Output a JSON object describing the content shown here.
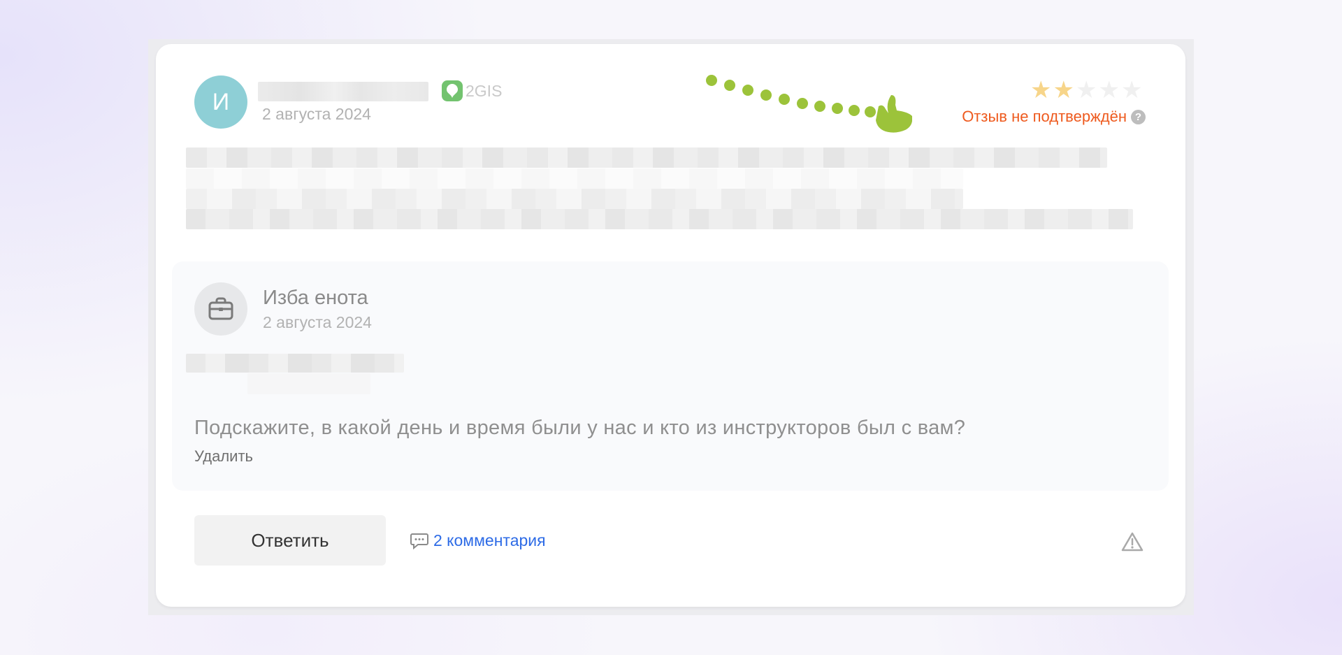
{
  "review": {
    "avatar_initial": "И",
    "source_label": "2GIS",
    "date": "2 августа 2024",
    "rating": 2,
    "max_rating": 5,
    "status_text": "Отзыв не подтверждён",
    "help_symbol": "?"
  },
  "org_reply": {
    "name": "Изба енота",
    "date": "2 августа 2024",
    "question": "Подскажите, в какой день и время были у нас и кто из инструкторов был с вам?",
    "delete_label": "Удалить"
  },
  "actions": {
    "reply_label": "Ответить",
    "comments_label": "2 комментария"
  },
  "colors": {
    "avatar": "#8ecfd6",
    "status": "#ee5a1e",
    "link": "#2d6be6",
    "star_active": "#f7d58a",
    "source_brand": "#73c36f",
    "arrow": "#9cc33a"
  },
  "icons": [
    "2gis-logo-icon",
    "help-icon",
    "briefcase-icon",
    "comment-icon",
    "warning-icon",
    "star-icon",
    "arrow-pointer-icon"
  ]
}
